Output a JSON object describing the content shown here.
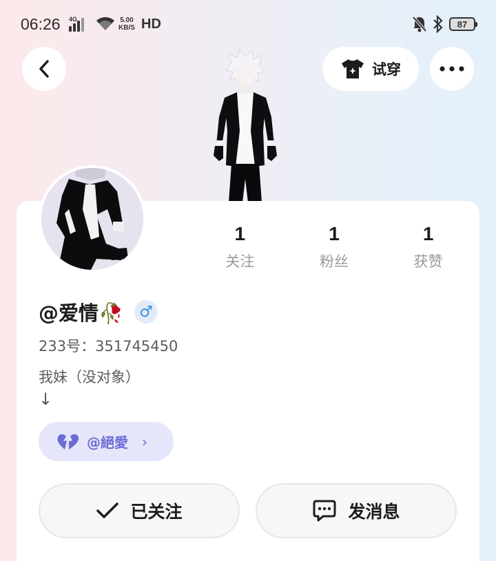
{
  "status_bar": {
    "time": "06:26",
    "network_type": "4G",
    "speed_value": "5.00",
    "speed_unit": "KB/S",
    "hd": "HD",
    "battery": "87"
  },
  "header": {
    "try_on_label": "试穿"
  },
  "profile": {
    "stats": [
      {
        "value": "1",
        "label": "关注"
      },
      {
        "value": "1",
        "label": "粉丝"
      },
      {
        "value": "1",
        "label": "获赞"
      }
    ],
    "username": "@爱情🥀",
    "gender_symbol": "♂",
    "uid": "233号：351745450",
    "bio_line1": "我妹（没对象）",
    "bio_line2": "↓",
    "relation": {
      "label": "@絕愛",
      "chevron": "›"
    }
  },
  "actions": {
    "follow_label": "已关注",
    "message_label": "发消息"
  },
  "colors": {
    "relation_bg": "#e6e6fb",
    "relation_text": "#6b6bd6",
    "gender_blue": "#3d8fe0"
  }
}
